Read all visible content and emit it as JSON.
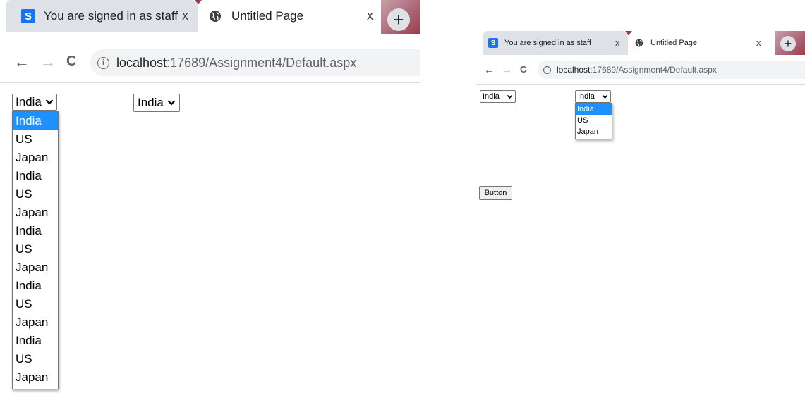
{
  "left": {
    "tabs": [
      {
        "favicon_letter": "S",
        "title": "You are signed in as staff",
        "close": "x"
      },
      {
        "favicon": "globe-icon",
        "title": "Untitled Page",
        "close": "x"
      }
    ],
    "new_tab": "+",
    "toolbar": {
      "back": "←",
      "forward": "→",
      "reload": "C",
      "info": "i",
      "url_host": "localhost",
      "url_path": ":17689/Assignment4/Default.aspx"
    },
    "select1": {
      "value": "India",
      "options": [
        "India",
        "US",
        "Japan",
        "India",
        "US",
        "Japan",
        "India",
        "US",
        "Japan",
        "India",
        "US",
        "Japan",
        "India",
        "US",
        "Japan"
      ]
    },
    "select2": {
      "value": "India"
    }
  },
  "right": {
    "tabs": [
      {
        "favicon_letter": "S",
        "title": "You are signed in as staff",
        "close": "x"
      },
      {
        "favicon": "globe-icon",
        "title": "Untitled Page",
        "close": "x"
      }
    ],
    "new_tab": "+",
    "toolbar": {
      "back": "←",
      "forward": "→",
      "reload": "C",
      "info": "i",
      "url_host": "localhost",
      "url_path": ":17689/Assignment4/Default.aspx"
    },
    "select1": {
      "value": "India"
    },
    "select2": {
      "value": "India",
      "options": [
        "India",
        "US",
        "Japan"
      ]
    },
    "button": "Button"
  },
  "colors": {
    "tab_inactive": "#dee1e6",
    "option_selected": "#1e90ff",
    "favicon": "#1a73e8",
    "omnibox": "#f1f3f4"
  }
}
